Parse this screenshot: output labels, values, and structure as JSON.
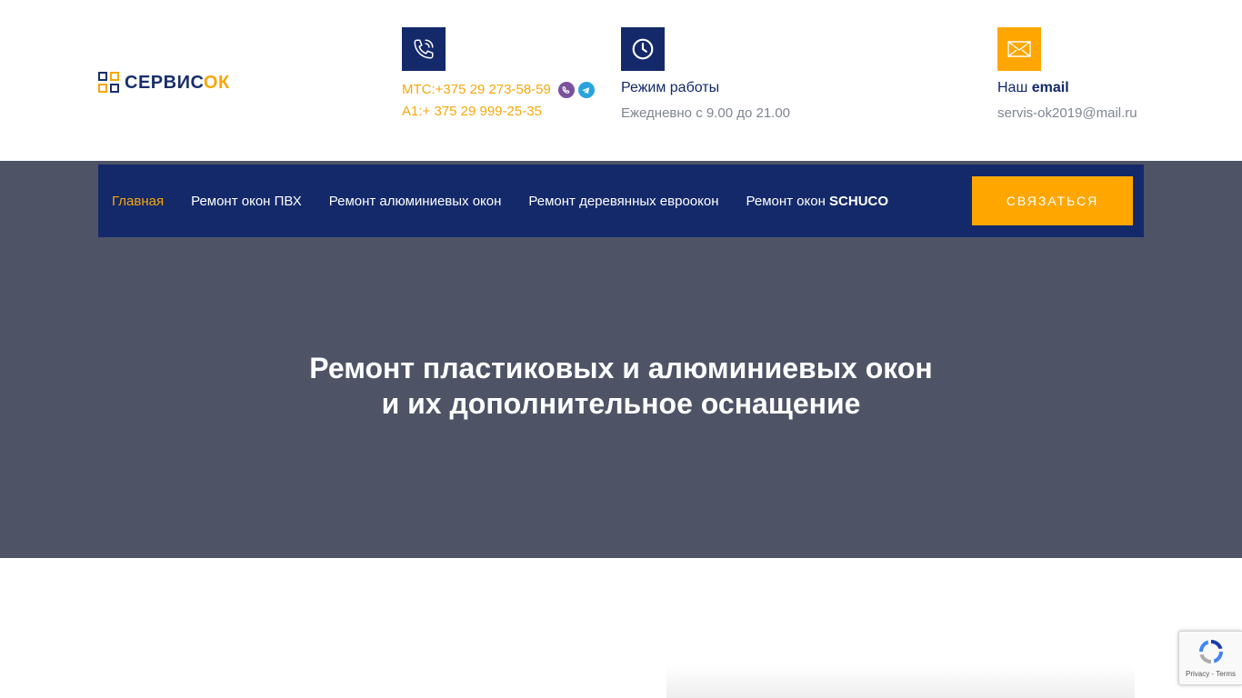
{
  "logo": {
    "part1": "СЕРВИС",
    "part2": "ОК"
  },
  "contacts": {
    "phone": {
      "icon": "phone-icon",
      "line1": "МТС:+375 29 273-58-59",
      "line2": "А1:+ 375 29 999-25-35",
      "viber_icon": "viber-icon",
      "telegram_icon": "telegram-icon"
    },
    "hours": {
      "icon": "clock-icon",
      "title": "Режим работы",
      "value": "Ежедневно с 9.00 до 21.00"
    },
    "email": {
      "icon": "envelope-icon",
      "title_plain": "Наш ",
      "title_bold": "email",
      "value": "servis-ok2019@mail.ru"
    }
  },
  "nav": {
    "items": [
      {
        "label": "Главная",
        "active": true
      },
      {
        "label": "Ремонт окон ПВХ"
      },
      {
        "label": "Ремонт алюминиевых окон"
      },
      {
        "label": "Ремонт деревянных евроокон"
      }
    ],
    "schuco": {
      "prefix": "Ремонт окон ",
      "bold": "SCHUCO"
    },
    "cta_label": "СВЯЗАТЬСЯ"
  },
  "hero": {
    "line1": "Ремонт пластиковых и алюминиевых окон",
    "line2": "и их дополнительное оснащение"
  },
  "recaptcha": {
    "links": "Privacy - Terms"
  },
  "colors": {
    "navy": "#13296a",
    "orange": "#ffa700",
    "hero_bg": "#4e5466"
  }
}
